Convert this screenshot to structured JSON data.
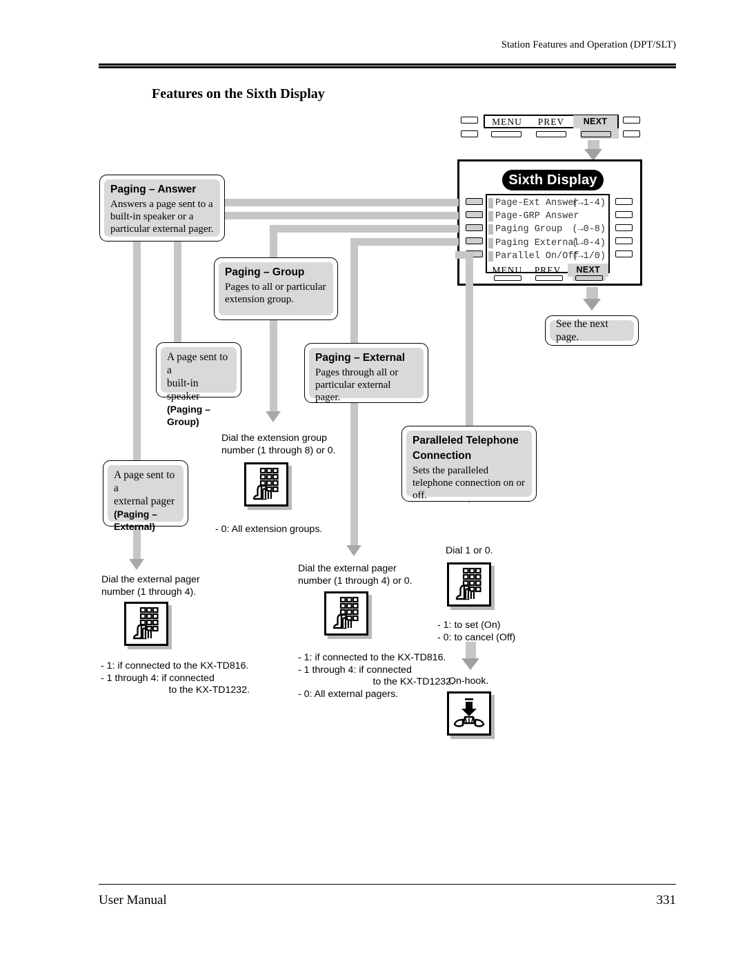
{
  "header": {
    "running_head": "Station Features and Operation (DPT/SLT)"
  },
  "page_title": "Features on the Sixth Display",
  "footer": {
    "left": "User Manual",
    "page_number": "331"
  },
  "top_strip": {
    "softkeys": [
      {
        "label": "MENU",
        "highlighted": false
      },
      {
        "label": "PREV",
        "highlighted": false
      },
      {
        "label": "NEXT",
        "highlighted": true
      }
    ]
  },
  "display_panel": {
    "title": "Sixth Display",
    "rows": [
      {
        "label": "Page-Ext Answer",
        "range": "(→1-4)"
      },
      {
        "label": "Page-GRP Answer",
        "range": ""
      },
      {
        "label": "Paging Group",
        "range": "(→0-8)"
      },
      {
        "label": "Paging External",
        "range": "(→0-4)"
      },
      {
        "label": "Parallel On/Off",
        "range": "(→1/0)"
      }
    ],
    "softkeys": [
      {
        "label": "MENU",
        "highlighted": false
      },
      {
        "label": "PREV",
        "highlighted": false
      },
      {
        "label": "NEXT",
        "highlighted": true
      }
    ]
  },
  "next_page_box": {
    "text": "See the next page."
  },
  "features": {
    "paging_answer": {
      "title": "Paging – Answer",
      "body": "Answers a page sent to a built-in speaker or a particular external pager."
    },
    "paging_group": {
      "title": "Paging – Group",
      "body": "Pages to all or particular extension group."
    },
    "paging_external": {
      "title": "Paging – External",
      "body": "Pages through all or particular external pager."
    },
    "paralleled": {
      "title_line1": "Paralleled Telephone",
      "title_line2": "Connection",
      "body": "Sets the paralleled telephone connection on or off."
    }
  },
  "result_boxes": {
    "builtin_speaker": {
      "line1": "A page sent to a",
      "line2": "built-in speaker",
      "bold": "(Paging – Group)"
    },
    "external_pager": {
      "line1": "A page sent to a",
      "line2": "external pager",
      "bold1": "(Paging –",
      "bold2": "External)"
    }
  },
  "steps": {
    "ext_group": {
      "instruction_l1": "Dial the extension group",
      "instruction_l2": "number (1 through 8) or 0.",
      "icon": "keypad-dial-icon",
      "note1": "- 0: All extension groups."
    },
    "ext_pager_left": {
      "instruction_l1": "Dial the external pager",
      "instruction_l2": "number (1 through 4).",
      "icon": "keypad-dial-icon",
      "note1": "- 1: if connected to the KX-TD816.",
      "note2": "- 1 through 4: if connected",
      "note3": "to the KX-TD1232."
    },
    "ext_pager_mid": {
      "instruction_l1": "Dial the external pager",
      "instruction_l2": "number (1 through 4) or 0.",
      "icon": "keypad-dial-icon",
      "note1": "- 1: if connected to the KX-TD816.",
      "note2": "- 1 through 4: if connected",
      "note3": "to the KX-TD1232.",
      "note4": "- 0: All external pagers."
    },
    "parallel": {
      "instruction_l1": "Dial 1 or 0.",
      "icon": "keypad-dial-icon",
      "note1": "- 1: to set (On)",
      "note2": "- 0: to cancel (Off)",
      "onhook_label": "On-hook.",
      "onhook_icon": "on-hook-handset-icon"
    }
  },
  "colors": {
    "connector": "#c6c6c6",
    "arrow": "#a8a8a8",
    "box_fill": "#d9d9d9",
    "highlight": "#d2d2d2",
    "ink": "#000000"
  }
}
